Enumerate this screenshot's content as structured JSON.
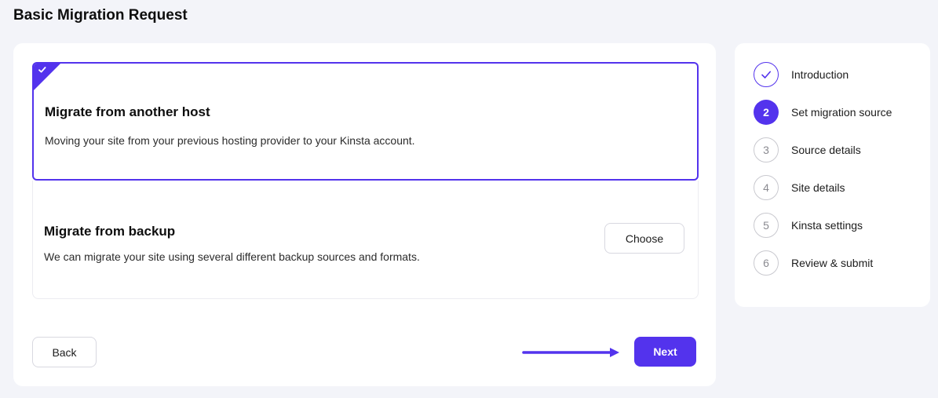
{
  "page": {
    "title": "Basic Migration Request"
  },
  "options": {
    "host": {
      "title": "Migrate from another host",
      "description": "Moving your site from your previous hosting provider to your Kinsta account."
    },
    "backup": {
      "title": "Migrate from backup",
      "description": "We can migrate your site using several different backup sources and formats.",
      "button_label": "Choose"
    }
  },
  "footer": {
    "back_label": "Back",
    "next_label": "Next"
  },
  "steps": [
    {
      "number": "",
      "label": "Introduction",
      "state": "done"
    },
    {
      "number": "2",
      "label": "Set migration source",
      "state": "active"
    },
    {
      "number": "3",
      "label": "Source details",
      "state": "pending"
    },
    {
      "number": "4",
      "label": "Site details",
      "state": "pending"
    },
    {
      "number": "5",
      "label": "Kinsta settings",
      "state": "pending"
    },
    {
      "number": "6",
      "label": "Review & submit",
      "state": "pending"
    }
  ],
  "colors": {
    "accent": "#5333ed",
    "background": "#f3f4f9"
  },
  "icons": {
    "selected": "check-icon",
    "step_done": "check-icon",
    "annotation": "arrow-right-icon"
  }
}
